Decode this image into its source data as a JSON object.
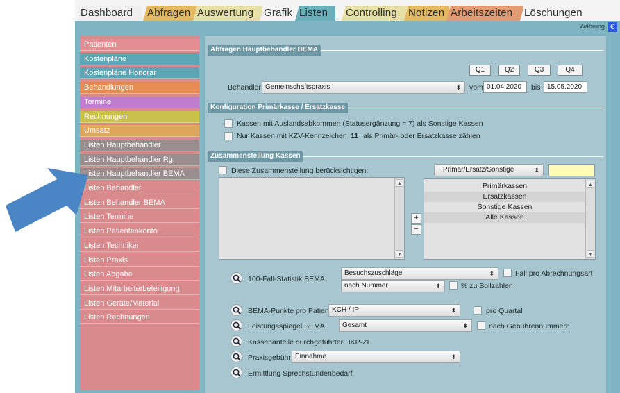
{
  "tabs": [
    "Dashboard",
    "Abfragen",
    "Auswertung",
    "Grafik",
    "Listen",
    "Controlling",
    "Notizen",
    "Arbeitszeiten",
    "Löschungen"
  ],
  "tab_colors": [
    "#efefef",
    "#e4b860",
    "#e7e0a6",
    "#f4f4f4",
    "#6ab0ba",
    "#e7e0a6",
    "#e4b860",
    "#e49b72",
    "#f4f4f4"
  ],
  "waehrung": {
    "label": "Währung",
    "symbol": "€"
  },
  "sidebar": {
    "items": [
      {
        "label": "Patienten",
        "color": "#e38e93"
      },
      {
        "label": "Kostenpläne",
        "color": "#5aa6b4"
      },
      {
        "label": "Kostenpläne Honorar",
        "color": "#5aa6b4"
      },
      {
        "label": "Behandlungen",
        "color": "#e58c52"
      },
      {
        "label": "Termine",
        "color": "#c07dcf"
      },
      {
        "label": "Rechnungen",
        "color": "#c9c04e"
      },
      {
        "label": "Umsatz",
        "color": "#dea65a"
      },
      {
        "label": "Listen Hauptbehandler",
        "color": "#9a8d8d"
      },
      {
        "label": "Listen Hauptbehandler Rg.",
        "color": "#9a8d8d"
      },
      {
        "label": "Listen Hauptbehandler BEMA",
        "color": "#9a8d8d"
      },
      {
        "label": "Listen Behandler",
        "color": "#d98a8d"
      },
      {
        "label": "Listen Behandler BEMA",
        "color": "#d98a8d"
      },
      {
        "label": "Listen Termine",
        "color": "#d98a8d"
      },
      {
        "label": "Listen Patientenkonto",
        "color": "#d98a8d"
      },
      {
        "label": "Listen Techniker",
        "color": "#d98a8d"
      },
      {
        "label": "Listen Praxis",
        "color": "#d98a8d"
      },
      {
        "label": "Listen Abgabe",
        "color": "#d98a8d"
      },
      {
        "label": "Listen Mitarbeiterbeteiligung",
        "color": "#d98a8d"
      },
      {
        "label": "Listen Geräte/Material",
        "color": "#d98a8d"
      },
      {
        "label": "Listen Rechnungen",
        "color": "#d98a8d"
      }
    ]
  },
  "main": {
    "section1_title": "Abfragen Hauptbehandler BEMA",
    "quarter_buttons": [
      "Q1",
      "Q2",
      "Q3",
      "Q4"
    ],
    "behandler_label": "Behandler",
    "behandler_value": "Gemeinschaftspraxis",
    "vom_label": "vom",
    "vom_value": "01.04.2020",
    "bis_label": "bis",
    "bis_value": "15.05.2020",
    "section2_title": "Konfiguration Primärkasse / Ersatzkasse",
    "check_ausland": "Kassen mit Auslandsabkommen (Statusergänzung = 7) als Sonstige Kassen",
    "check_kzv_prefix": "Nur Kassen mit KZV-Kennzeichen",
    "check_kzv_number": "11",
    "check_kzv_suffix": "als Primär- oder Ersatzkasse zählen",
    "section3_title": "Zusammenstellung Kassen",
    "check_zusammenstellung": "Diese Zusammenstellung berücksichtigen:",
    "kassen_select": "Primär/Ersatz/Sonstige",
    "kassen_list": [
      "Primärkassen",
      "Ersatzkassen",
      "Sonstige Kassen",
      "Alle Kassen"
    ],
    "plus": "+",
    "minus": "−",
    "fallstatistik_label": "100-Fall-Statistik BEMA",
    "fallstatistik_select1": "Besuchszuschläge",
    "fallstatistik_select2": "nach Nummer",
    "fall_pro_abrechnungsart": "Fall pro Abrechnungsart",
    "zu_sollzahlen": "% zu Sollzahlen",
    "bema_punkte_label": "BEMA-Punkte pro Patient",
    "bema_punkte_select": "KCH / IP",
    "pro_quartal": "pro Quartal",
    "leistungsspiegel_label": "Leistungsspiegel BEMA",
    "leistungsspiegel_select": "Gesamt",
    "nach_gebuehrennummern": "nach Gebührennummern",
    "kassenanteile_label": "Kassenanteile durchgeführter HKP-ZE",
    "praxisgebuehr_label": "Praxisgebühr",
    "praxisgebuehr_select": "Einnahme",
    "sprechstunden_label": "Ermittlung Sprechstundenbedarf"
  }
}
